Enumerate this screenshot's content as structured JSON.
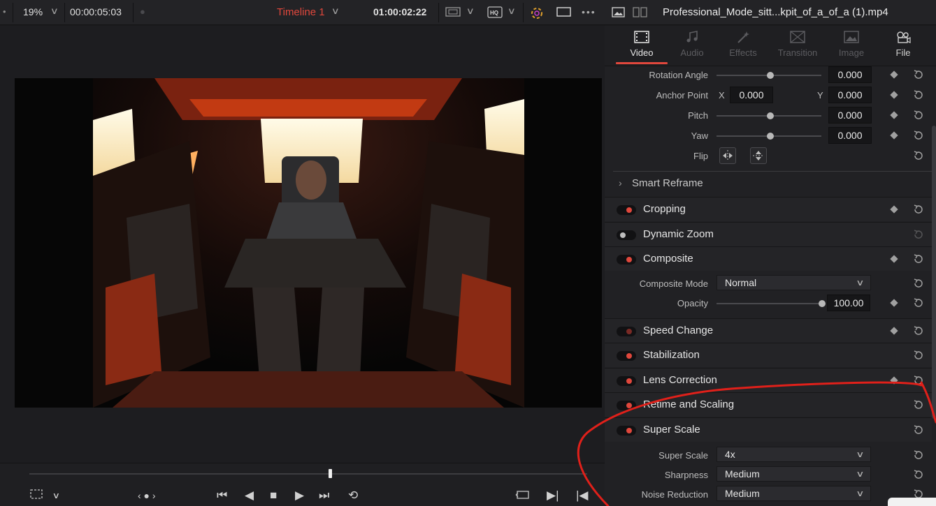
{
  "topbar": {
    "zoom": "19%",
    "source_timecode": "00:00:05:03",
    "timeline_name": "Timeline 1",
    "record_timecode": "01:00:02:22"
  },
  "inspector": {
    "clip_name": "Professional_Mode_sitt...kpit_of_a_of_a (1).mp4",
    "tabs": [
      {
        "label": "Video",
        "active": true
      },
      {
        "label": "Audio",
        "active": false
      },
      {
        "label": "Effects",
        "active": false
      },
      {
        "label": "Transition",
        "active": false
      },
      {
        "label": "Image",
        "active": false
      },
      {
        "label": "File",
        "active": false
      }
    ],
    "transform": {
      "rotation_label": "Rotation Angle",
      "rotation_value": "0.000",
      "anchor_label": "Anchor Point",
      "anchor_x_axis": "X",
      "anchor_x": "0.000",
      "anchor_y_axis": "Y",
      "anchor_y": "0.000",
      "pitch_label": "Pitch",
      "pitch_value": "0.000",
      "yaw_label": "Yaw",
      "yaw_value": "0.000",
      "flip_label": "Flip"
    },
    "sections": {
      "smart_reframe": "Smart Reframe",
      "cropping": "Cropping",
      "dynamic_zoom": "Dynamic Zoom",
      "composite": "Composite",
      "speed_change": "Speed Change",
      "stabilization": "Stabilization",
      "lens_correction": "Lens Correction",
      "retime_scaling": "Retime and Scaling",
      "super_scale": "Super Scale"
    },
    "composite": {
      "mode_label": "Composite Mode",
      "mode_value": "Normal",
      "opacity_label": "Opacity",
      "opacity_value": "100.00"
    },
    "super_scale": {
      "scale_label": "Super Scale",
      "scale_value": "4x",
      "sharpness_label": "Sharpness",
      "sharpness_value": "Medium",
      "noise_label": "Noise Reduction",
      "noise_value": "Medium"
    }
  },
  "colors": {
    "accent": "#e0473c",
    "annotation": "#e0201a"
  }
}
